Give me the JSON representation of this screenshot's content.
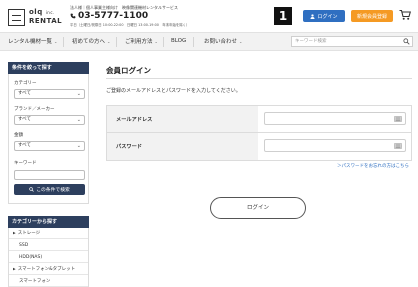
{
  "header": {
    "logo_top": "olq",
    "logo_inc": "inc.",
    "logo_bottom": "RENTAL",
    "tagline": "法人様｜個人事業主様向け　映像関連機材レンタルサービス",
    "phone": "03-5777-1100",
    "hours": "平日（土曜日/祝祭日 10:00-22:00　日曜日 13:00-19:00　年末年始を除く）",
    "badge": "1",
    "login_label": "ログイン",
    "register_label": "新規会員登録"
  },
  "nav": {
    "items": [
      {
        "label": "レンタル機材一覧",
        "chevron": "⌄"
      },
      {
        "label": "初めての方へ",
        "chevron": "⌄"
      },
      {
        "label": "ご利用方法",
        "chevron": "⌄"
      },
      {
        "label": "BLOG",
        "chevron": ""
      },
      {
        "label": "お問い合わせ",
        "chevron": "⌄"
      }
    ],
    "search_placeholder": "キーワード検索"
  },
  "sidebar": {
    "filter_title": "条件を絞って探す",
    "category_label": "カテゴリー",
    "category_value": "すべて",
    "brand_label": "ブランド／メーカー",
    "brand_value": "すべて",
    "price_label": "金額",
    "price_value": "すべて",
    "keyword_label": "キーワード",
    "search_button": "この条件で検索",
    "category_title": "カテゴリーから探す",
    "categories": [
      {
        "label": "ストレージ",
        "type": "top"
      },
      {
        "label": "SSD",
        "type": "sub"
      },
      {
        "label": "HDD(NAS)",
        "type": "sub"
      },
      {
        "label": "スマートフォン&タブレット",
        "type": "top"
      },
      {
        "label": "スマートフォン",
        "type": "sub"
      }
    ]
  },
  "main": {
    "title": "会員ログイン",
    "intro": "ご登録のメールアドレスとパスワードを入力してください。",
    "email_label": "メールアドレス",
    "password_label": "パスワード",
    "forgot_link": "＞パスワードをお忘れの方はこちら",
    "login_button": "ログイン"
  },
  "colors": {
    "accent_blue": "#2f6fc1",
    "accent_orange": "#f59a23",
    "sidebar_navy": "#2d3f5e"
  }
}
